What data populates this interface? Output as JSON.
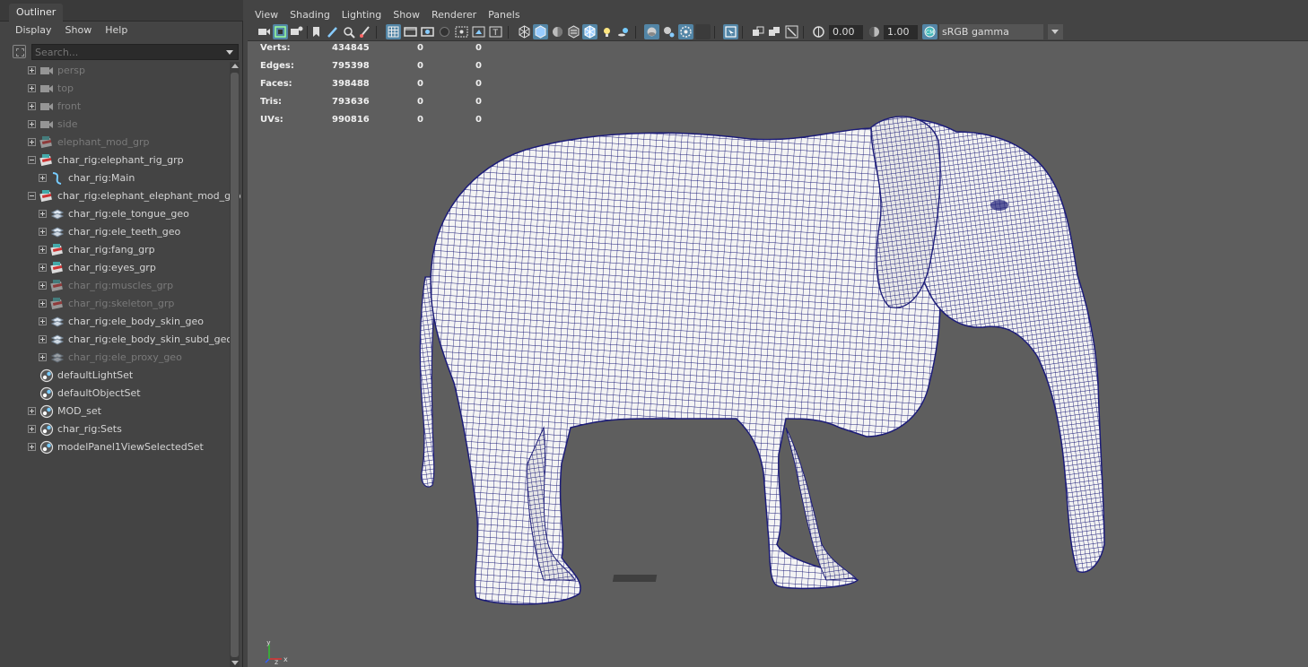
{
  "outliner": {
    "tab_label": "Outliner",
    "menu": [
      "Display",
      "Show",
      "Help"
    ],
    "search_placeholder": "Search...",
    "tree": [
      {
        "label": "persp",
        "depth": 0,
        "icon": "camera-icon",
        "expand": "plus",
        "dim": true
      },
      {
        "label": "top",
        "depth": 0,
        "icon": "camera-icon",
        "expand": "plus",
        "dim": true
      },
      {
        "label": "front",
        "depth": 0,
        "icon": "camera-icon",
        "expand": "plus",
        "dim": true
      },
      {
        "label": "side",
        "depth": 0,
        "icon": "camera-icon",
        "expand": "plus",
        "dim": true
      },
      {
        "label": "elephant_mod_grp",
        "depth": 0,
        "icon": "group-icon",
        "expand": "plus",
        "dim": true
      },
      {
        "label": "char_rig:elephant_rig_grp",
        "depth": 0,
        "icon": "group-icon",
        "expand": "minus",
        "dim": false
      },
      {
        "label": "char_rig:Main",
        "depth": 1,
        "icon": "curve-icon",
        "expand": "plus",
        "dim": false
      },
      {
        "label": "char_rig:elephant_elephant_mod_grp",
        "depth": 0,
        "icon": "group-icon",
        "expand": "minus",
        "dim": false
      },
      {
        "label": "char_rig:ele_tongue_geo",
        "depth": 1,
        "icon": "mesh-icon",
        "expand": "plus",
        "dim": false
      },
      {
        "label": "char_rig:ele_teeth_geo",
        "depth": 1,
        "icon": "mesh-icon",
        "expand": "plus",
        "dim": false
      },
      {
        "label": "char_rig:fang_grp",
        "depth": 1,
        "icon": "group-icon",
        "expand": "plus",
        "dim": false
      },
      {
        "label": "char_rig:eyes_grp",
        "depth": 1,
        "icon": "group-icon",
        "expand": "plus",
        "dim": false
      },
      {
        "label": "char_rig:muscles_grp",
        "depth": 1,
        "icon": "group-icon",
        "expand": "plus",
        "dim": true
      },
      {
        "label": "char_rig:skeleton_grp",
        "depth": 1,
        "icon": "group-icon",
        "expand": "plus",
        "dim": true
      },
      {
        "label": "char_rig:ele_body_skin_geo",
        "depth": 1,
        "icon": "mesh-icon",
        "expand": "plus",
        "dim": false
      },
      {
        "label": "char_rig:ele_body_skin_subd_geo",
        "depth": 1,
        "icon": "mesh-icon",
        "expand": "plus",
        "dim": false
      },
      {
        "label": "char_rig:ele_proxy_geo",
        "depth": 1,
        "icon": "mesh-icon",
        "expand": "plus",
        "dim": true
      },
      {
        "label": "defaultLightSet",
        "depth": 0,
        "icon": "set-icon",
        "expand": "none",
        "dim": false
      },
      {
        "label": "defaultObjectSet",
        "depth": 0,
        "icon": "set-icon",
        "expand": "none",
        "dim": false
      },
      {
        "label": "MOD_set",
        "depth": 0,
        "icon": "set-icon",
        "expand": "plus",
        "dim": false
      },
      {
        "label": "char_rig:Sets",
        "depth": 0,
        "icon": "set-icon",
        "expand": "plus",
        "dim": false
      },
      {
        "label": "modelPanel1ViewSelectedSet",
        "depth": 0,
        "icon": "set-icon",
        "expand": "plus",
        "dim": false
      }
    ]
  },
  "panel": {
    "menu": [
      "View",
      "Shading",
      "Lighting",
      "Show",
      "Renderer",
      "Panels"
    ],
    "exposure": "0.00",
    "gamma": "1.00",
    "colorspace": "sRGB gamma"
  },
  "hud": [
    {
      "label": "Verts:",
      "v1": "434845",
      "v2": "0",
      "v3": "0"
    },
    {
      "label": "Edges:",
      "v1": "795398",
      "v2": "0",
      "v3": "0"
    },
    {
      "label": "Faces:",
      "v1": "398488",
      "v2": "0",
      "v3": "0"
    },
    {
      "label": "Tris:",
      "v1": "793636",
      "v2": "0",
      "v3": "0"
    },
    {
      "label": "UVs:",
      "v1": "990816",
      "v2": "0",
      "v3": "0"
    }
  ],
  "axis": {
    "x": "x",
    "y": "y",
    "z": "z"
  },
  "colors": {
    "wire": "#1a1a6e",
    "mesh_fill": "#f2f2f2",
    "viewport_bg": "#5e5e5e",
    "highlight": "#5285a6"
  }
}
